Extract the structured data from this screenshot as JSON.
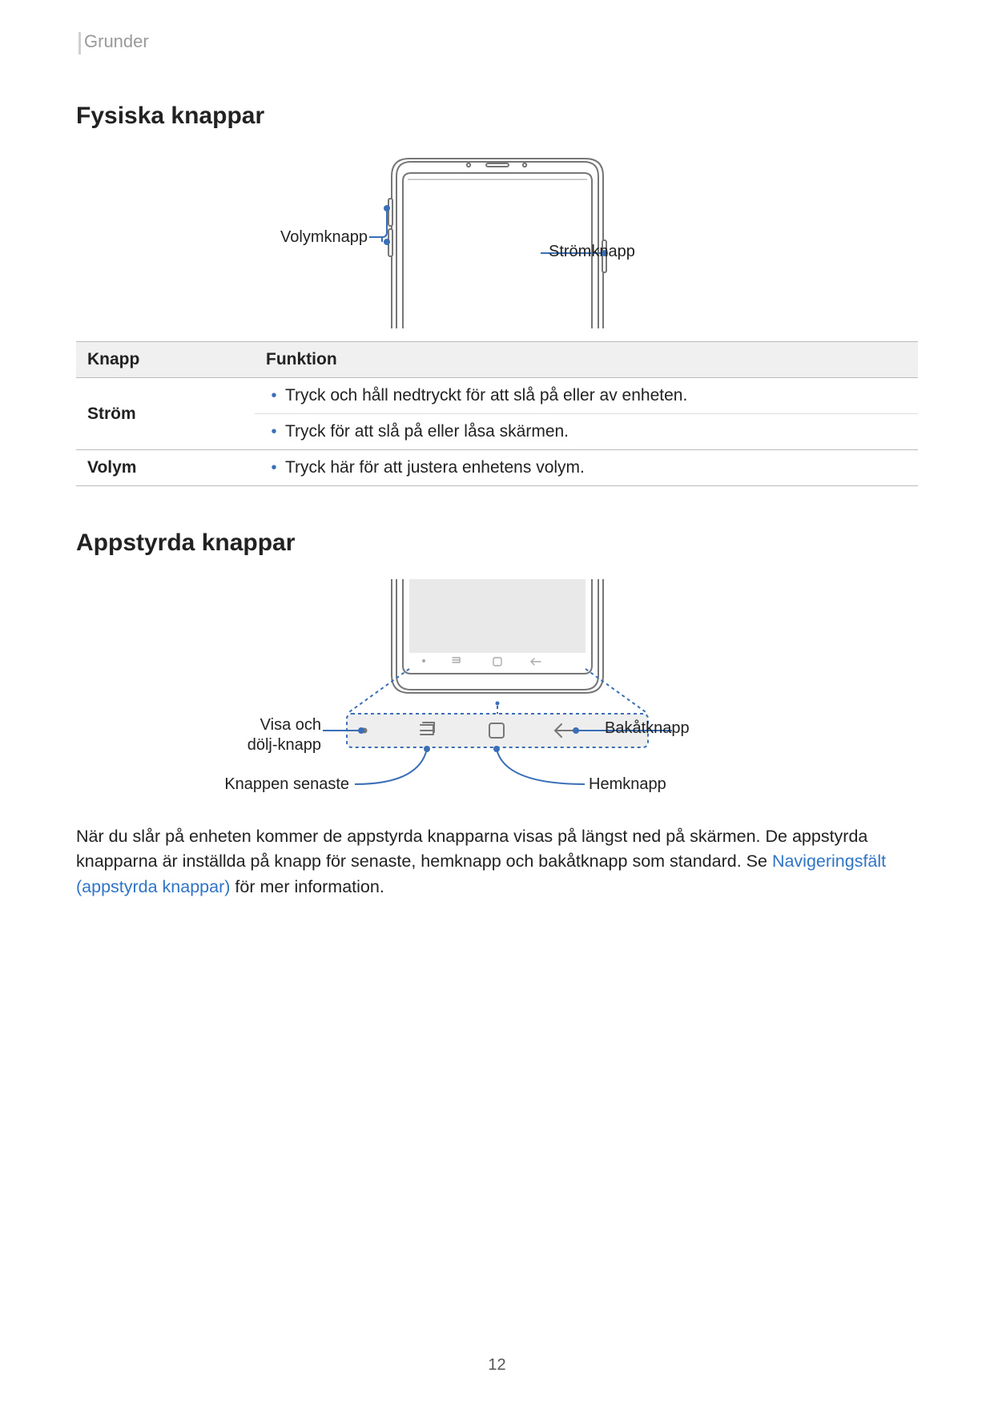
{
  "running_head": "Grunder",
  "page_number": "12",
  "section1_title": "Fysiska knappar",
  "section2_title": "Appstyrda knappar",
  "fig1": {
    "volume_label": "Volymknapp",
    "power_label": "Strömknapp"
  },
  "table": {
    "head_key": "Knapp",
    "head_fn": "Funktion",
    "rows": [
      {
        "name": "Ström",
        "items": [
          "Tryck och håll nedtryckt för att slå på eller av enheten.",
          "Tryck för att slå på eller låsa skärmen."
        ]
      },
      {
        "name": "Volym",
        "items": [
          "Tryck här för att justera enhetens volym."
        ]
      }
    ]
  },
  "fig2": {
    "show_hide_label_1": "Visa och",
    "show_hide_label_2": "dölj-knapp",
    "recents_label": "Knappen senaste",
    "back_label": "Bakåtknapp",
    "home_label": "Hemknapp"
  },
  "para": {
    "p1": "När du slår på enheten kommer de appstyrda knapparna visas på längst ned på skärmen. De appstyrda knapparna är inställda på knapp för senaste, hemknapp och bakåtknapp som standard. Se ",
    "link": "Navigeringsfält (appstyrda knappar)",
    "p2": " för mer information."
  }
}
